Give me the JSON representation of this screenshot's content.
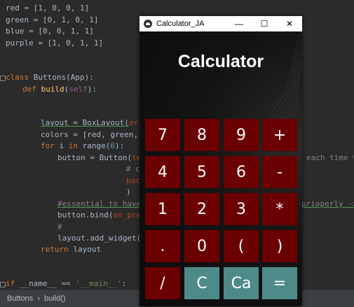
{
  "editor": {
    "lines": {
      "l1": "red = [1, 0, 0, 1]",
      "l2": "green = [0, 1, 0, 1]",
      "l3": "blue = [0, 0, 1, 1]",
      "l4": "purple = [1, 0, 1, 1]",
      "l5a": "class ",
      "l5b": "Buttons(App):",
      "l6a": "def ",
      "l6b": "build",
      "l6c": "(",
      "l6d": "self",
      "l6e": "):",
      "l7a": "layout = BoxLayout(",
      "l7b": "orie",
      "l8": "colors = [red, green, b",
      "l9a": "for ",
      "l9b": "i ",
      "l9c": "in ",
      "l9d": "range(",
      "l9e": "6",
      "l9f": "):",
      "l10a": "button = Button(",
      "l10b": "tex",
      "l10r": "each time %",
      "l11": "# c",
      "l12": "bac",
      "l13": ")",
      "l14a": "#essential to have",
      "l14b": "prioperly ->",
      "l15a": "button.bind(",
      "l15b": "on_pres",
      "l16": "#",
      "l17": "layout.add_widget(b",
      "l18a": "return ",
      "l18b": "layout",
      "l19a": "if ",
      "l19b": "__name__ == ",
      "l19c": "'__main__'",
      "l19d": ":"
    }
  },
  "statusbar": {
    "crumb1": "Buttons",
    "sep": "›",
    "crumb2": "build()"
  },
  "window": {
    "title": "Calculator_JA",
    "minimize": "—",
    "maximize": "☐",
    "close": "✕"
  },
  "calculator": {
    "title": "Calculator",
    "colors": {
      "key_dark_red": "#6b0000",
      "key_teal": "#4e8b88"
    },
    "keys": [
      {
        "label": "7",
        "style": "red"
      },
      {
        "label": "8",
        "style": "red"
      },
      {
        "label": "9",
        "style": "red"
      },
      {
        "label": "+",
        "style": "red"
      },
      {
        "label": "4",
        "style": "red"
      },
      {
        "label": "5",
        "style": "red"
      },
      {
        "label": "6",
        "style": "red"
      },
      {
        "label": "-",
        "style": "red"
      },
      {
        "label": "1",
        "style": "red"
      },
      {
        "label": "2",
        "style": "red"
      },
      {
        "label": "3",
        "style": "red"
      },
      {
        "label": "*",
        "style": "red"
      },
      {
        "label": ".",
        "style": "red"
      },
      {
        "label": "0",
        "style": "red"
      },
      {
        "label": "(",
        "style": "red"
      },
      {
        "label": ")",
        "style": "red"
      },
      {
        "label": "/",
        "style": "red"
      },
      {
        "label": "C",
        "style": "teal"
      },
      {
        "label": "Ca",
        "style": "teal"
      },
      {
        "label": "=",
        "style": "teal"
      }
    ]
  }
}
